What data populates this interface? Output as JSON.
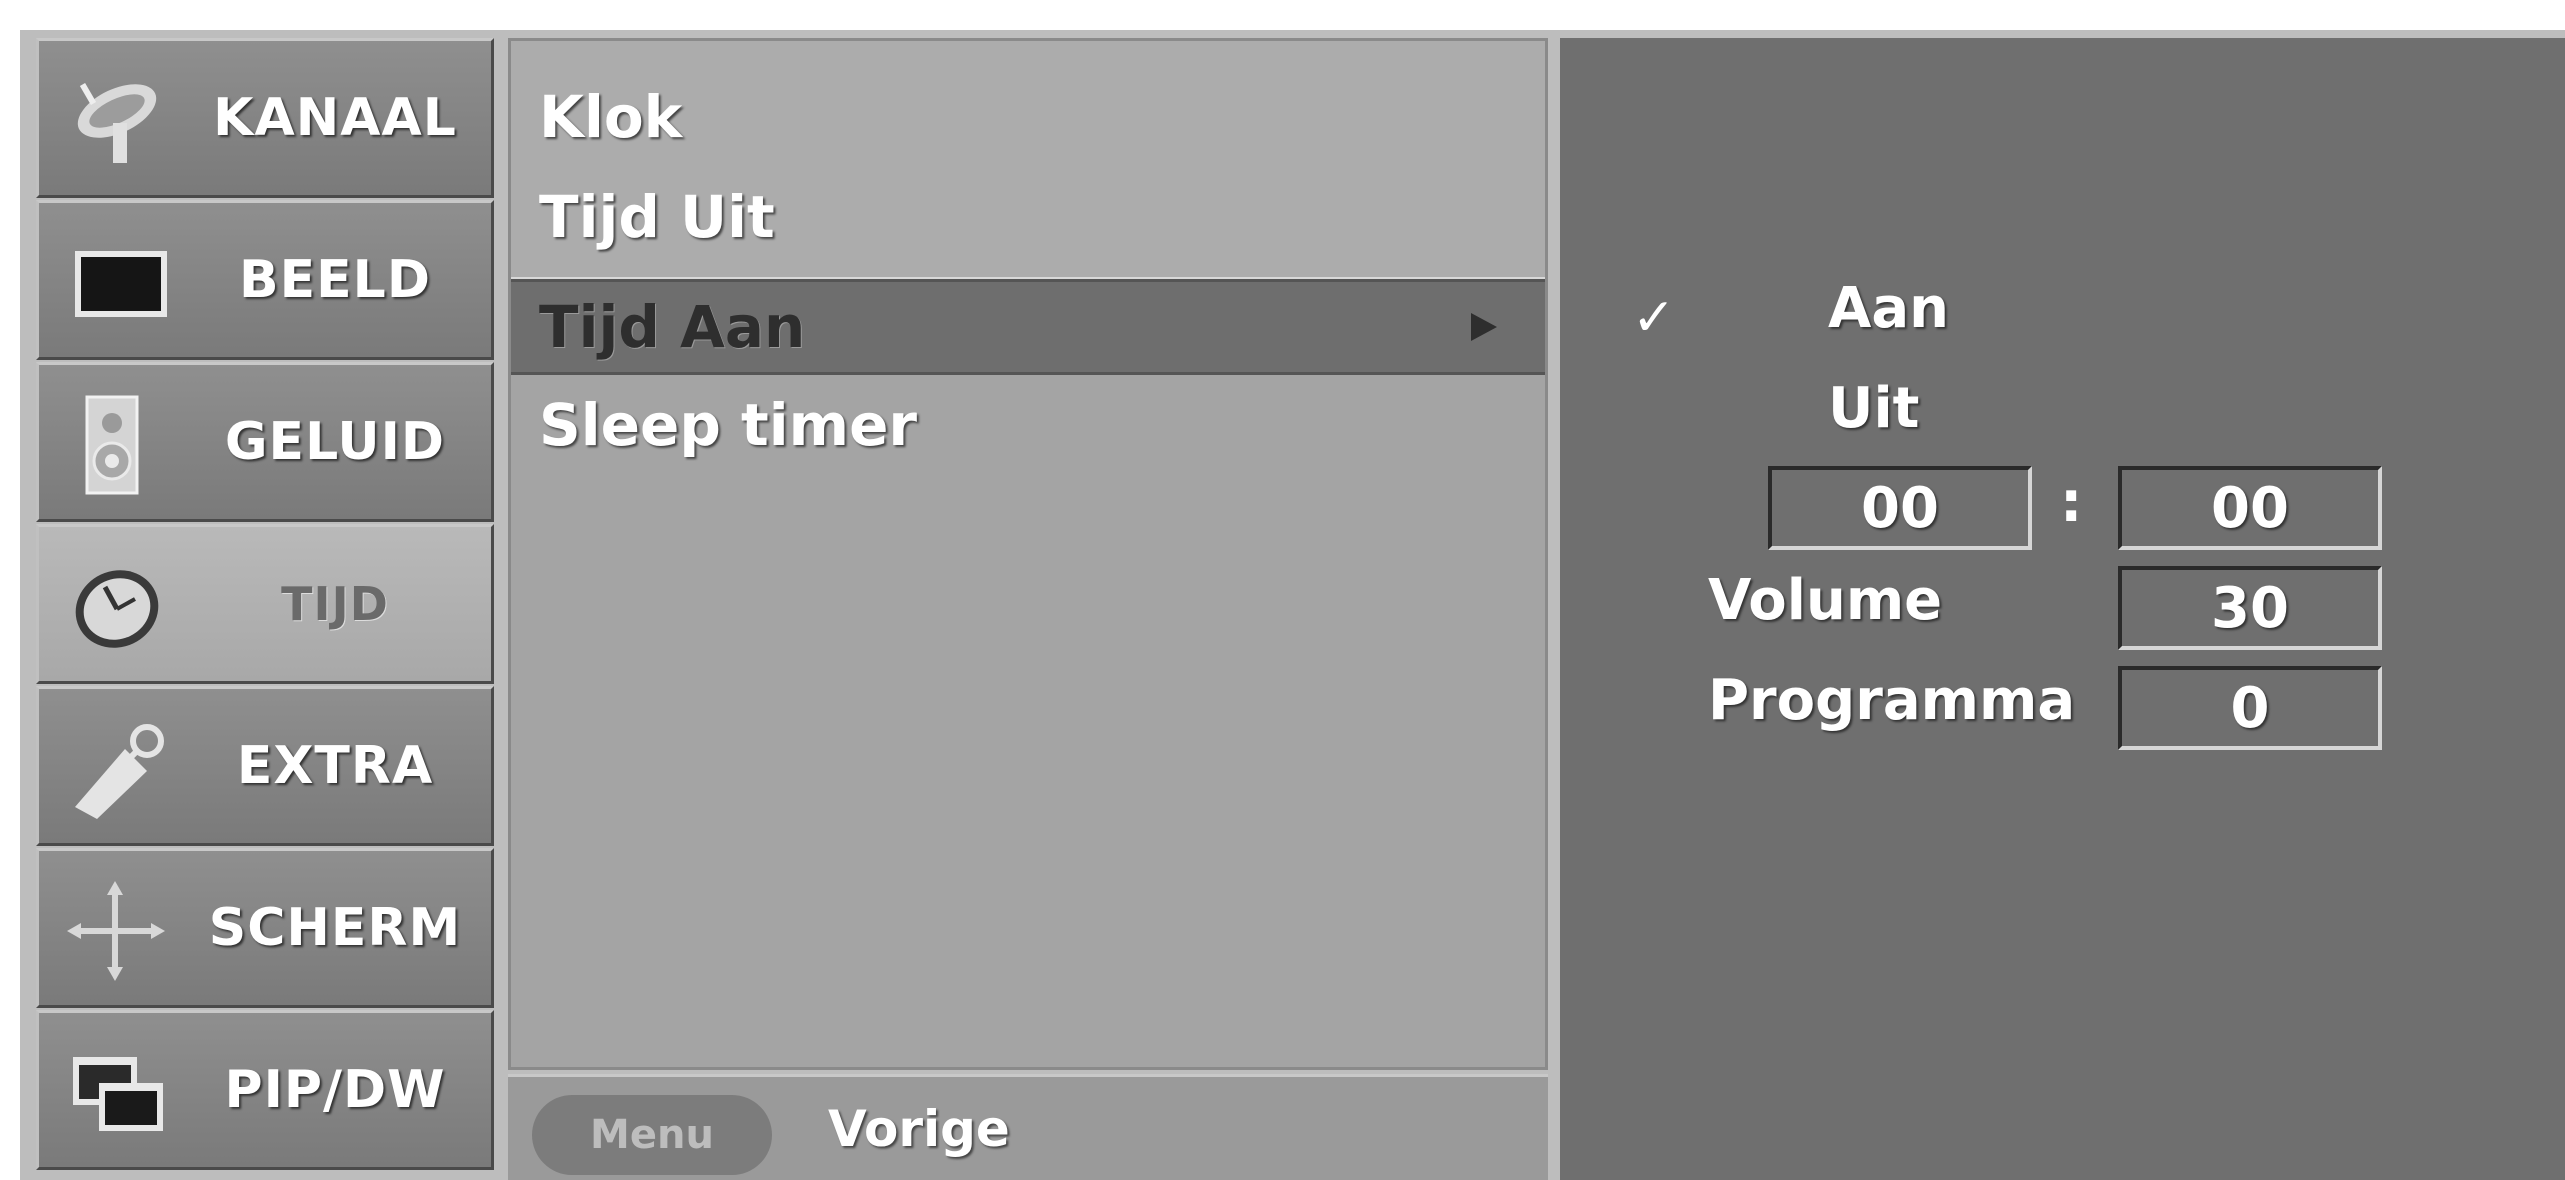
{
  "sidebar": {
    "items": [
      {
        "label": "KANAAL",
        "icon": "satellite-dish-icon"
      },
      {
        "label": "BEELD",
        "icon": "screen-icon"
      },
      {
        "label": "GELUID",
        "icon": "speaker-icon"
      },
      {
        "label": "TIJD",
        "icon": "clock-icon",
        "active": true
      },
      {
        "label": "EXTRA",
        "icon": "tag-icon"
      },
      {
        "label": "SCHERM",
        "icon": "move-arrows-icon"
      },
      {
        "label": "PIP/DW",
        "icon": "pip-windows-icon"
      }
    ]
  },
  "menu": {
    "items": [
      {
        "label": "Klok"
      },
      {
        "label": "Tijd Uit"
      },
      {
        "label": "Tijd Aan",
        "selected": true
      },
      {
        "label": "Sleep timer"
      }
    ]
  },
  "footer": {
    "menu_button": "Menu",
    "back_label": "Vorige"
  },
  "submenu": {
    "option_on": "Aan",
    "option_off": "Uit",
    "hour": "00",
    "colon": ":",
    "minute": "00",
    "volume_label": "Volume",
    "volume_value": "30",
    "program_label": "Programma",
    "program_value": "0"
  }
}
